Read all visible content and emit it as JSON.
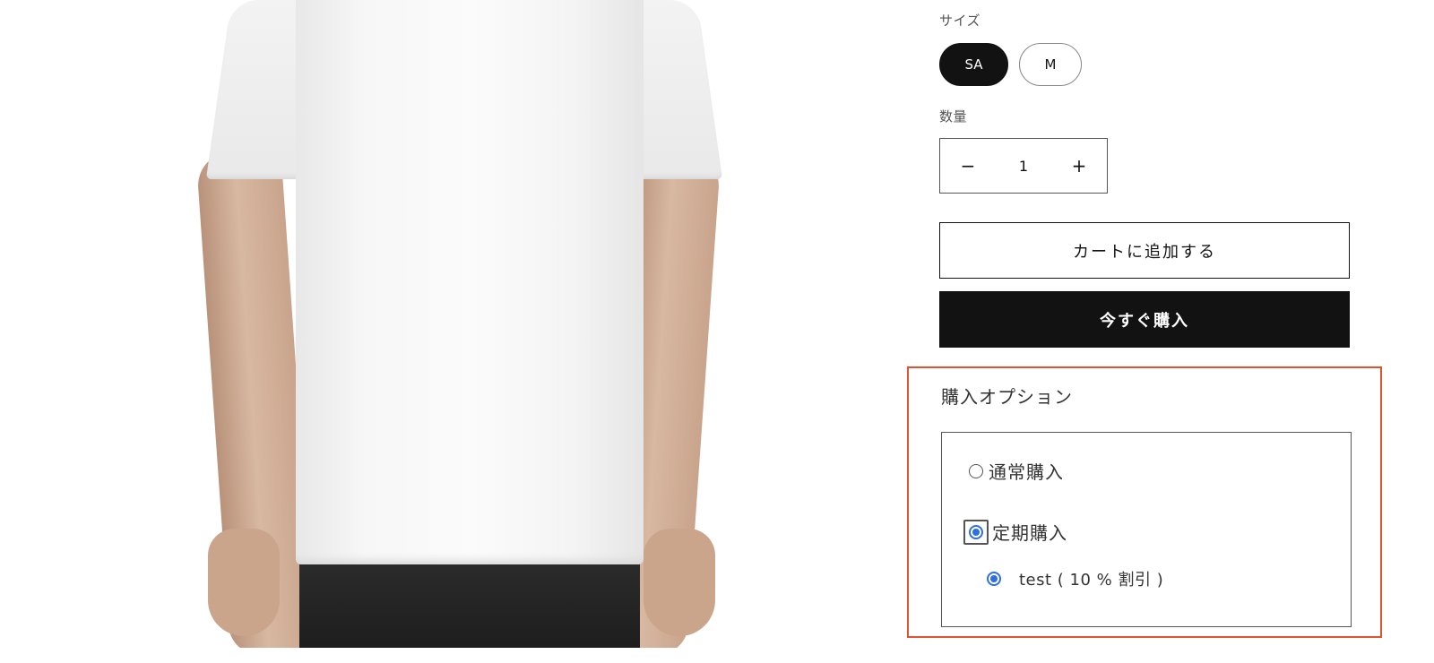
{
  "product": {
    "image_alt": "white-tshirt-photo"
  },
  "size": {
    "label": "サイズ",
    "options": [
      "SA",
      "M"
    ],
    "selected": "SA"
  },
  "quantity": {
    "label": "数量",
    "decrease": "−",
    "value": "1",
    "increase": "+"
  },
  "actions": {
    "add_to_cart": "カートに追加する",
    "buy_now": "今すぐ購入"
  },
  "purchase_options": {
    "title": "購入オプション",
    "one_time_label": "通常購入",
    "subscription_label": "定期購入",
    "selected": "定期購入",
    "plans": [
      {
        "label": "test ( 10 % 割引 )",
        "selected": true
      }
    ]
  },
  "colors": {
    "primary": "#121212",
    "highlight_border": "#e0532f",
    "radio_accent": "#2f6fe0"
  }
}
